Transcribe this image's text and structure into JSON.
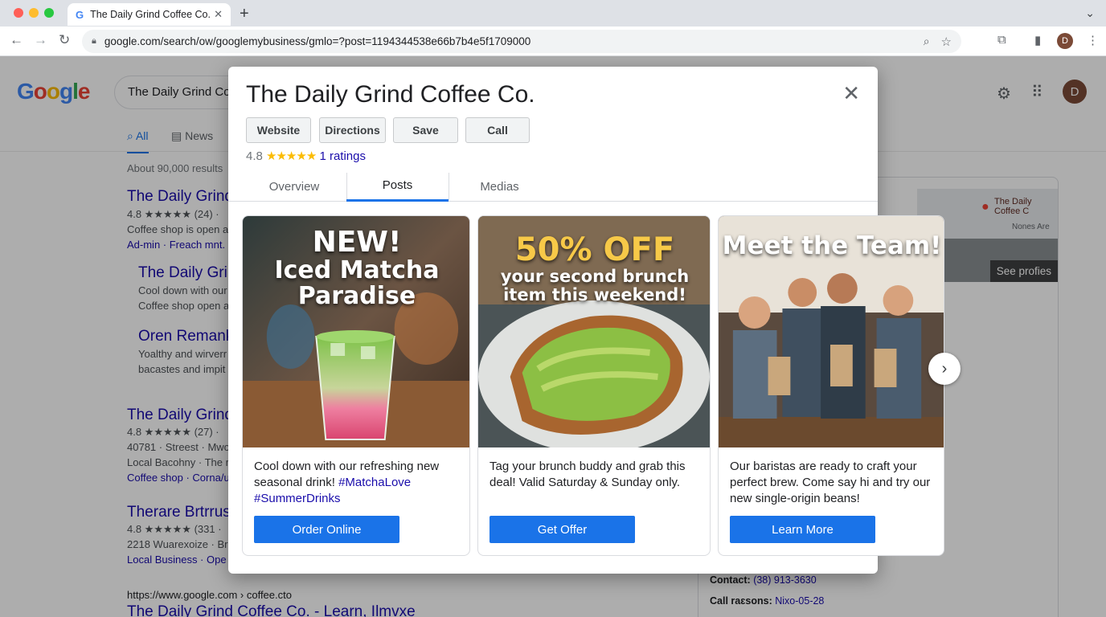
{
  "browser": {
    "tab_title": "The Daily Grind Coffee Co.",
    "url": "google.com/search/ow/googlemybusiness/gmlo=?post=1194344538e66b7b4e5f1709000",
    "profile_initial": "D"
  },
  "google": {
    "logo": "Google",
    "query": "The Daily Grind Coffee Co.",
    "avatar_initial": "D",
    "tabs": [
      "All",
      "News"
    ],
    "results_count": "About 90,000 results"
  },
  "results": [
    {
      "title": "The Daily Grind",
      "line1": "4.8 ★★★★★ (24) ·",
      "line2": "Coffee shop is open a",
      "line3": "Ad-min · Freach mnt. I"
    },
    {
      "title": "The Daily Grin",
      "line1": "Cool down with our",
      "line2": "Coffee shop open a"
    },
    {
      "title": "Oren Remank",
      "line1": "Yoalthy and wirverr",
      "line2": "bacastes and impit"
    },
    {
      "title": "The Daily Grind",
      "line1": "4.8 ★★★★★ (27) ·",
      "line2": "40781 · Streest · Mwo",
      "line3": "Local Bacohny · The r",
      "line4": "Coffee shop · Corna/u"
    },
    {
      "title": "Therare Brtrrus",
      "line1": "4.8 ★★★★★ (331 ·",
      "line2": "2218 Wuareхoize · Bri",
      "line3": "Local Business · Ope"
    }
  ],
  "bottom_result": {
    "url": "https://www.google.com › coffee.cto",
    "title": "The Daily Grind Coffee Co. - Learn, Ilmvxe"
  },
  "knowledge_panel": {
    "map_label": "The Daily Coffee C",
    "map_road": "Nones Are",
    "photos_label": "See profies",
    "contact_label": "Contact:",
    "contact_value": "(38) 913-3630",
    "call_label": "Call raɛsons:",
    "call_value": "Nixo-05-28"
  },
  "modal": {
    "title": "The Daily Grind Coffee Co.",
    "actions": [
      "Website",
      "Directions",
      "Save",
      "Call"
    ],
    "rating_value": "4.8",
    "rating_stars": "★★★★★",
    "rating_count": "1 ratings",
    "tabs": [
      "Overview",
      "Posts",
      "Medias"
    ],
    "active_tab": "Posts",
    "posts": [
      {
        "headline1": "NEW!",
        "headline2": "Iced Matcha",
        "headline3": "Paradise",
        "text": "Cool down with our refreshing new seasonal drink!",
        "tags": "#MatchaLove #SummerDrinks",
        "button": "Order Online"
      },
      {
        "headline1": "50% OFF",
        "headline2": "your second brunch",
        "headline3": "item this weekend!",
        "text": "Tag your brunch buddy and grab this deal! Valid Saturday & Sunday only.",
        "button": "Get Offer"
      },
      {
        "headline1": "Meet the Team!",
        "text": "Our baristas are ready to craft your perfect brew. Come say hi and try our new single-origin beans!",
        "button": "Learn More"
      }
    ]
  },
  "colors": {
    "accent": "#1a73e8",
    "link": "#1a0dab",
    "star": "#fbbc04"
  }
}
